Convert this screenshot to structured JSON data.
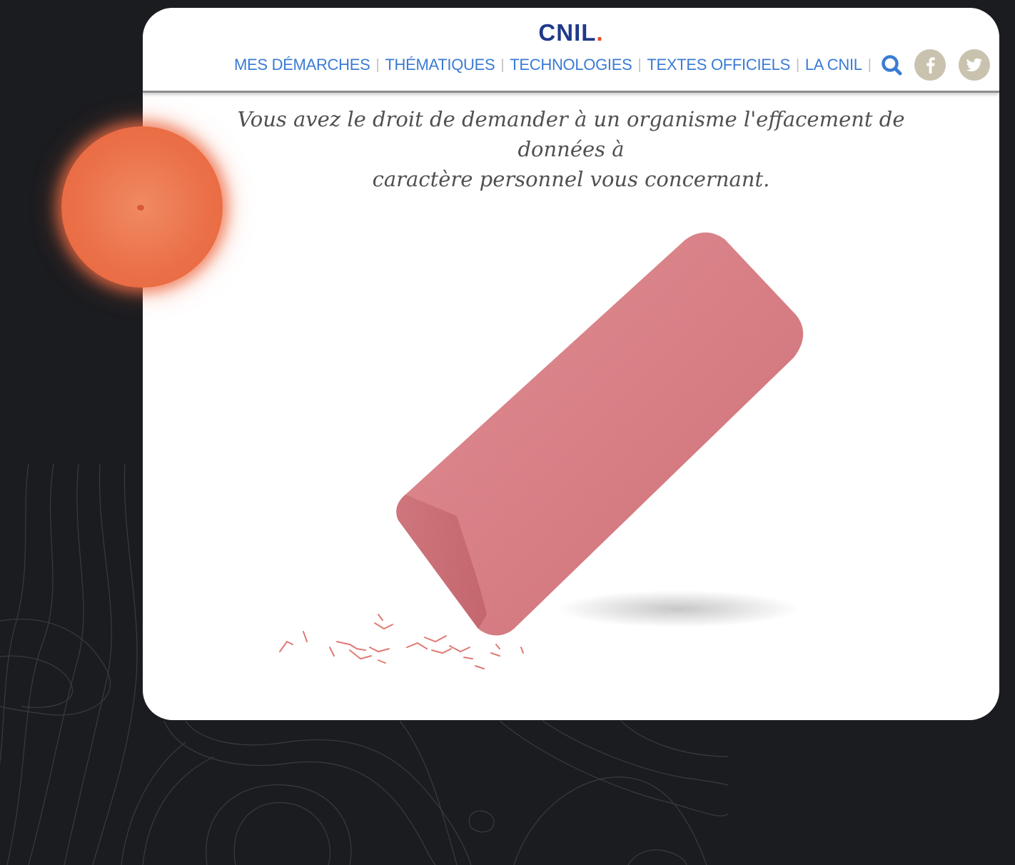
{
  "header": {
    "logo_text": "CNIL",
    "logo_dot": ".",
    "nav": [
      {
        "label": "MES DÉMARCHES"
      },
      {
        "label": "THÉMATIQUES"
      },
      {
        "label": "TECHNOLOGIES"
      },
      {
        "label": "TEXTES OFFICIELS"
      },
      {
        "label": "LA CNIL"
      }
    ],
    "separator": "|",
    "icons": [
      "search-icon",
      "facebook-icon",
      "twitter-icon"
    ]
  },
  "main": {
    "tagline_line1": "Vous avez le droit de demander à un organisme l'effacement de données à",
    "tagline_line2": "caractère personnel vous concernant."
  },
  "colors": {
    "page_background": "#1b1c20",
    "logo": "#1f3a8a",
    "logo_dot": "#e84a2a",
    "nav_link": "#3b7bd4",
    "social_icon_bg": "#c9c2ae",
    "eraser": "#d9727a",
    "orange_dot": "#eb7149"
  }
}
